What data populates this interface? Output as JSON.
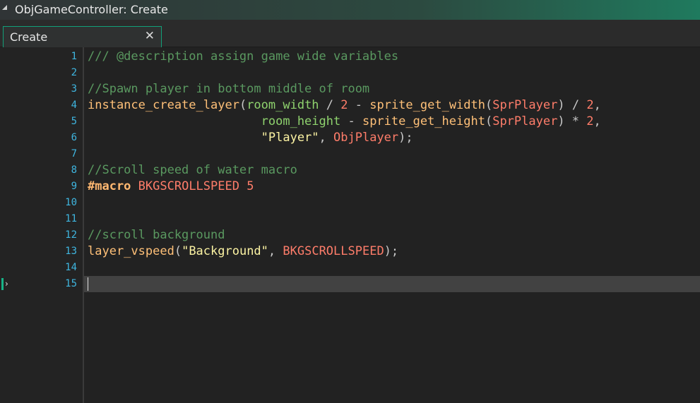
{
  "window": {
    "title": "ObjGameController: Create"
  },
  "tab": {
    "label": "Create",
    "close_glyph": "✕"
  },
  "icons": {
    "collapse": "collapse-triangle-icon",
    "close": "close-icon",
    "line_marker": "current-line-arrow-icon"
  },
  "colors": {
    "accent": "#17b388",
    "line_number": "#3fb6e0",
    "comment": "#5a9960",
    "function": "#ffc078",
    "builtin": "#8fd36e",
    "number": "#ff7d6a",
    "string": "#fcf3a3"
  },
  "editor": {
    "current_line": 15,
    "lines": [
      {
        "num": "1",
        "tokens": [
          {
            "t": "comment",
            "v": "/// @description assign game wide variables"
          }
        ]
      },
      {
        "num": "2",
        "tokens": []
      },
      {
        "num": "3",
        "tokens": [
          {
            "t": "comment",
            "v": "//Spawn player in bottom middle of room"
          }
        ]
      },
      {
        "num": "4",
        "tokens": [
          {
            "t": "func",
            "v": "instance_create_layer"
          },
          {
            "t": "op",
            "v": "("
          },
          {
            "t": "builtin",
            "v": "room_width"
          },
          {
            "t": "op",
            "v": " / "
          },
          {
            "t": "num",
            "v": "2"
          },
          {
            "t": "op",
            "v": " - "
          },
          {
            "t": "func",
            "v": "sprite_get_width"
          },
          {
            "t": "op",
            "v": "("
          },
          {
            "t": "asset",
            "v": "SprPlayer"
          },
          {
            "t": "op",
            "v": ") / "
          },
          {
            "t": "num",
            "v": "2"
          },
          {
            "t": "op",
            "v": ","
          }
        ]
      },
      {
        "num": "5",
        "tokens": [
          {
            "t": "op",
            "v": "                        "
          },
          {
            "t": "builtin",
            "v": "room_height"
          },
          {
            "t": "op",
            "v": " - "
          },
          {
            "t": "func",
            "v": "sprite_get_height"
          },
          {
            "t": "op",
            "v": "("
          },
          {
            "t": "asset",
            "v": "SprPlayer"
          },
          {
            "t": "op",
            "v": ") * "
          },
          {
            "t": "num",
            "v": "2"
          },
          {
            "t": "op",
            "v": ","
          }
        ]
      },
      {
        "num": "6",
        "tokens": [
          {
            "t": "op",
            "v": "                        "
          },
          {
            "t": "string",
            "v": "\"Player\""
          },
          {
            "t": "op",
            "v": ", "
          },
          {
            "t": "asset",
            "v": "ObjPlayer"
          },
          {
            "t": "op",
            "v": ");"
          }
        ]
      },
      {
        "num": "7",
        "tokens": []
      },
      {
        "num": "8",
        "tokens": [
          {
            "t": "comment",
            "v": "//Scroll speed of water macro"
          }
        ]
      },
      {
        "num": "9",
        "tokens": [
          {
            "t": "macrokw",
            "v": "#macro"
          },
          {
            "t": "op",
            "v": " "
          },
          {
            "t": "macro",
            "v": "BKGSCROLLSPEED"
          },
          {
            "t": "op",
            "v": " "
          },
          {
            "t": "num",
            "v": "5"
          }
        ]
      },
      {
        "num": "10",
        "tokens": []
      },
      {
        "num": "11",
        "tokens": []
      },
      {
        "num": "12",
        "tokens": [
          {
            "t": "comment",
            "v": "//scroll background"
          }
        ]
      },
      {
        "num": "13",
        "tokens": [
          {
            "t": "func",
            "v": "layer_vspeed"
          },
          {
            "t": "op",
            "v": "("
          },
          {
            "t": "string",
            "v": "\"Background\""
          },
          {
            "t": "op",
            "v": ", "
          },
          {
            "t": "macro",
            "v": "BKGSCROLLSPEED"
          },
          {
            "t": "op",
            "v": ");"
          }
        ]
      },
      {
        "num": "14",
        "tokens": []
      },
      {
        "num": "15",
        "tokens": []
      }
    ]
  }
}
